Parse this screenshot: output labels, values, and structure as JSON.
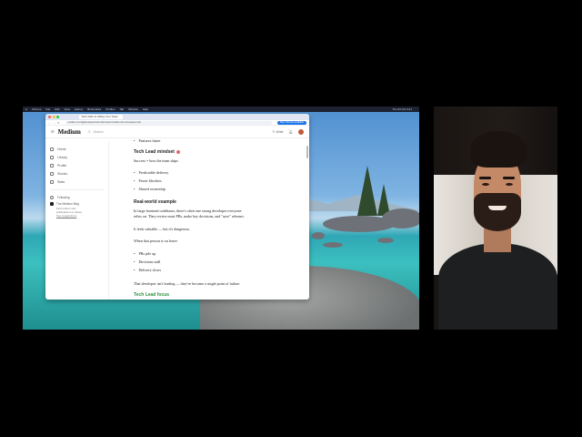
{
  "menubar": {
    "items": [
      "Chrome",
      "File",
      "Edit",
      "View",
      "History",
      "Bookmarks",
      "Profiles",
      "Tab",
      "Window",
      "Help"
    ],
    "clock": "Thu 23 Oct 9:41"
  },
  "browser": {
    "tab_title": "Tech Debt Is Killing Your Team",
    "url": "medium.com/@developer/tech-debt-lead-mindset-why-developers-fail",
    "relaunch_label": "New Chrome available"
  },
  "medium": {
    "logo": "Medium",
    "search_placeholder": "Search",
    "write_label": "Write"
  },
  "sidebar": {
    "items": [
      {
        "label": "Home",
        "icon": "home-icon"
      },
      {
        "label": "Library",
        "icon": "library-icon"
      },
      {
        "label": "Profile",
        "icon": "profile-icon"
      },
      {
        "label": "Stories",
        "icon": "stories-icon"
      },
      {
        "label": "Stats",
        "icon": "stats-icon"
      }
    ],
    "following_label": "Following",
    "following_item": "The Medium Blog",
    "hint_line1": "Find writers and",
    "hint_line2": "publications to follow.",
    "hint_link": "See suggestions"
  },
  "article": {
    "top_cutoff": "Features faster",
    "heading1": "Tech Lead mindset",
    "success_line": "Success = how the team ships",
    "bullets1": [
      "Predictable delivery",
      "Fewer blockers",
      "Shared ownership"
    ],
    "heading2": "Real-world example",
    "para1_line1": "In large frontend codebases, there's often one strong developer everyone",
    "para1_line2": "relies on. They review most PRs, make key decisions, and \"save\" releases.",
    "para2": "It feels valuable — but it's dangerous.",
    "para3": "When that person is on leave:",
    "bullets2": [
      "PRs pile up",
      "Decisions stall",
      "Delivery slows"
    ],
    "para4": "That developer isn't leading — they've become a single point of failure.",
    "bottom_cutoff": "Tech Lead focus"
  }
}
